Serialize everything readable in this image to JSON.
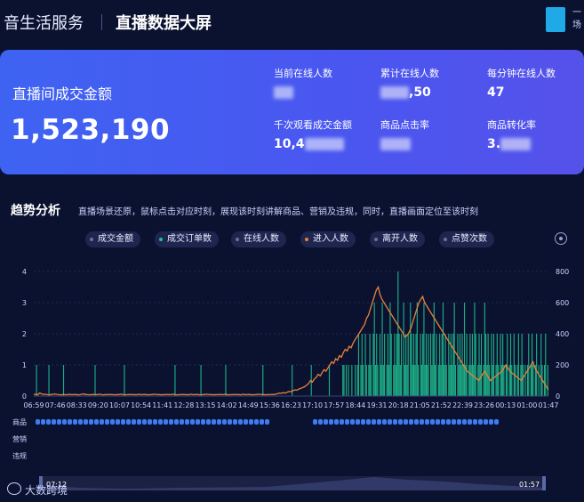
{
  "header": {
    "brand": "音生活服务",
    "screen_title": "直播数据大屏",
    "user_text": "一 场"
  },
  "kpi": {
    "gmv_label": "直播间成交金额",
    "gmv_value": "1,523,190",
    "metrics": [
      {
        "label": "当前在线人数",
        "value": ""
      },
      {
        "label": "累计在线人数",
        "value": ",50"
      },
      {
        "label": "每分钟在线人数",
        "value": "47"
      },
      {
        "label": "千次观看成交金额",
        "value": "10,4"
      },
      {
        "label": "商品点击率",
        "value": ""
      },
      {
        "label": "商品转化率",
        "value": "3."
      }
    ]
  },
  "trend": {
    "title": "趋势分析",
    "description": "直播场景还原，鼠标点击对应时刻，展现该时刻讲解商品、营销及违规，同时，直播画面定位至该时刻",
    "legend": [
      {
        "label": "成交金额",
        "color": "#6a7196"
      },
      {
        "label": "成交订单数",
        "color": "#1fbf8f"
      },
      {
        "label": "在线人数",
        "color": "#6a7196"
      },
      {
        "label": "进入人数",
        "color": "#e8823a"
      },
      {
        "label": "离开人数",
        "color": "#6a7196"
      },
      {
        "label": "点赞次数",
        "color": "#6a7196"
      }
    ],
    "row_labels": [
      "商品",
      "营销",
      "违规"
    ],
    "range_start": "07:12",
    "range_end": "01:57"
  },
  "chart_data": {
    "type": "bar",
    "x_ticks": [
      "06:59",
      "07:46",
      "08:33",
      "09:20",
      "10:07",
      "10:54",
      "11:41",
      "12:28",
      "13:15",
      "14:02",
      "14:49",
      "15:36",
      "16:23",
      "17:10",
      "17:57",
      "18:44",
      "19:31",
      "20:18",
      "21:05",
      "21:52",
      "22:39",
      "23:26",
      "00:13",
      "01:00",
      "01:47"
    ],
    "y_left_ticks": [
      "0",
      "1",
      "2",
      "3",
      "4"
    ],
    "y_right_ticks": [
      "0",
      "200",
      "400",
      "600",
      "800"
    ],
    "ylim_left": [
      0,
      4
    ],
    "ylim_right": [
      0,
      800
    ],
    "series": [
      {
        "name": "成交订单数",
        "axis": "left",
        "style": "bar",
        "values": [
          0,
          0,
          1,
          0,
          0,
          0,
          0,
          0,
          0,
          0,
          0,
          0,
          0,
          1,
          0,
          0,
          0,
          0,
          0,
          0,
          0,
          0,
          0,
          0,
          0,
          0,
          1,
          0,
          0,
          0,
          0,
          0,
          0,
          0,
          0,
          0,
          0,
          0,
          0,
          0,
          0,
          0,
          0,
          0,
          0,
          0,
          0,
          0,
          0,
          0,
          0,
          0,
          0,
          0,
          1,
          0,
          0,
          0,
          0,
          0,
          0,
          0,
          0,
          0,
          0,
          0,
          0,
          0,
          0,
          0,
          0,
          0,
          0,
          0,
          0,
          0,
          0,
          0,
          0,
          0,
          1,
          0,
          0,
          0,
          0,
          0,
          0,
          0,
          0,
          0,
          0,
          0,
          0,
          0,
          0,
          0,
          0,
          0,
          0,
          0,
          0,
          0,
          0,
          0,
          0,
          0,
          0,
          0,
          0,
          0,
          0,
          0,
          0,
          0,
          0,
          0,
          0,
          0,
          0,
          0,
          0,
          0,
          0,
          0,
          0,
          1,
          0,
          0,
          0,
          0,
          0,
          0,
          0,
          0,
          0,
          0,
          0,
          0,
          0,
          0,
          0,
          0,
          0,
          0,
          0,
          0,
          0,
          0,
          1,
          0,
          0,
          0,
          0,
          0,
          0,
          0,
          0,
          0,
          0,
          0,
          0,
          0,
          0,
          0,
          0,
          0,
          0,
          0,
          0,
          0,
          1,
          0,
          0,
          0,
          0,
          0,
          0,
          0,
          0,
          0,
          0,
          0,
          0,
          0,
          0,
          0,
          0,
          0,
          0,
          0,
          0,
          0,
          0,
          0,
          0,
          0,
          0,
          0,
          0,
          0,
          0,
          0,
          0,
          1,
          0,
          0,
          0,
          0,
          0,
          0,
          0,
          0,
          0,
          0,
          0,
          0,
          0,
          0,
          0,
          0,
          0,
          0,
          0,
          0,
          0,
          0,
          0,
          0,
          0,
          1,
          0,
          0,
          0,
          0,
          0,
          0,
          0,
          0,
          0,
          0,
          0,
          0,
          0,
          0,
          0,
          0,
          1,
          0,
          0,
          0,
          0,
          0,
          0,
          0,
          0,
          0,
          0,
          0,
          0,
          0,
          0,
          0,
          1,
          0,
          0,
          0,
          0,
          0,
          0,
          0,
          0,
          0,
          0,
          0,
          1,
          1,
          0,
          1,
          0,
          1,
          0,
          0,
          1,
          0,
          0,
          1,
          0,
          1,
          2,
          0,
          1,
          2,
          1,
          0,
          2,
          1,
          0,
          1,
          2,
          1,
          0,
          2,
          3,
          1,
          2,
          1,
          0,
          2,
          1,
          3,
          1,
          2,
          0,
          1,
          2,
          1,
          3,
          2,
          0,
          1,
          2,
          1,
          2,
          4,
          2,
          1,
          2,
          0,
          3,
          1,
          2,
          1,
          2,
          0,
          3,
          2,
          1,
          2,
          1,
          2,
          3,
          1,
          0,
          2,
          1,
          2,
          3,
          1,
          2,
          1,
          2,
          0,
          2,
          1,
          2,
          3,
          1,
          2,
          0,
          1,
          2,
          1,
          2,
          3,
          1,
          2,
          1,
          0,
          2,
          1,
          2,
          1,
          2,
          3,
          1,
          0,
          2,
          1,
          2,
          1,
          2,
          1,
          3,
          1,
          2,
          0,
          1,
          2,
          1,
          2,
          1,
          3,
          2,
          0,
          1,
          2,
          1,
          2,
          0,
          1,
          3,
          2,
          1,
          2,
          1,
          0,
          2,
          1,
          2,
          0,
          1,
          2,
          1,
          0,
          2,
          1,
          2,
          1,
          0,
          1,
          2,
          0,
          1,
          2,
          1,
          0,
          2,
          1,
          0,
          1,
          2,
          0,
          1,
          2,
          1,
          0,
          1,
          0,
          1,
          2,
          0,
          1,
          2,
          1,
          0,
          1,
          2,
          0,
          1,
          0,
          2,
          1,
          0,
          1,
          2,
          0,
          1
        ]
      },
      {
        "name": "进入人数",
        "axis": "right",
        "style": "line",
        "values": [
          10,
          12,
          8,
          20,
          15,
          10,
          12,
          9,
          8,
          10,
          12,
          14,
          11,
          9,
          8,
          10,
          9,
          8,
          12,
          10,
          9,
          11,
          10,
          8,
          9,
          12,
          14,
          10,
          9,
          8,
          10,
          11,
          9,
          10,
          12,
          9,
          8,
          10,
          9,
          11,
          10,
          9,
          8,
          10,
          9,
          12,
          10,
          8,
          9,
          10,
          11,
          9,
          10,
          8,
          12,
          10,
          9,
          11,
          10,
          8,
          9,
          10,
          12,
          11,
          9,
          10,
          8,
          10,
          9,
          11,
          10,
          9,
          12,
          10,
          8,
          9,
          10,
          11,
          9,
          10,
          8,
          12,
          10,
          9,
          11,
          10,
          8,
          9,
          10,
          12,
          11,
          9,
          10,
          8,
          10,
          9,
          11,
          10,
          9,
          12,
          10,
          8,
          9,
          10,
          11,
          9,
          10,
          8,
          12,
          10,
          9,
          11,
          10,
          8,
          9,
          10,
          12,
          11,
          9,
          10,
          8,
          10,
          9,
          11,
          10,
          12,
          15,
          20,
          18,
          22,
          19,
          25,
          30,
          28,
          35,
          40,
          38,
          45,
          50,
          55,
          60,
          70,
          80,
          100,
          90,
          110,
          120,
          140,
          130,
          150,
          170,
          160,
          180,
          200,
          220,
          210,
          240,
          230,
          260,
          250,
          280,
          300,
          290,
          320,
          310,
          340,
          360,
          380,
          400,
          420,
          440,
          460,
          500,
          520,
          560,
          600,
          640,
          680,
          700,
          650,
          620,
          600,
          580,
          560,
          540,
          520,
          500,
          480,
          460,
          440,
          420,
          400,
          380,
          390,
          410,
          440,
          480,
          520,
          560,
          600,
          620,
          640,
          600,
          580,
          560,
          540,
          520,
          500,
          480,
          460,
          440,
          420,
          400,
          380,
          360,
          340,
          320,
          300,
          280,
          260,
          240,
          220,
          200,
          180,
          160,
          150,
          140,
          130,
          120,
          110,
          100,
          120,
          140,
          160,
          140,
          120,
          100,
          110,
          120,
          130,
          140,
          150,
          160,
          180,
          200,
          180,
          160,
          150,
          140,
          130,
          120,
          110,
          100,
          120,
          140,
          160,
          180,
          200,
          220,
          180,
          160,
          140,
          120,
          100,
          80,
          60,
          40
        ]
      }
    ]
  }
}
